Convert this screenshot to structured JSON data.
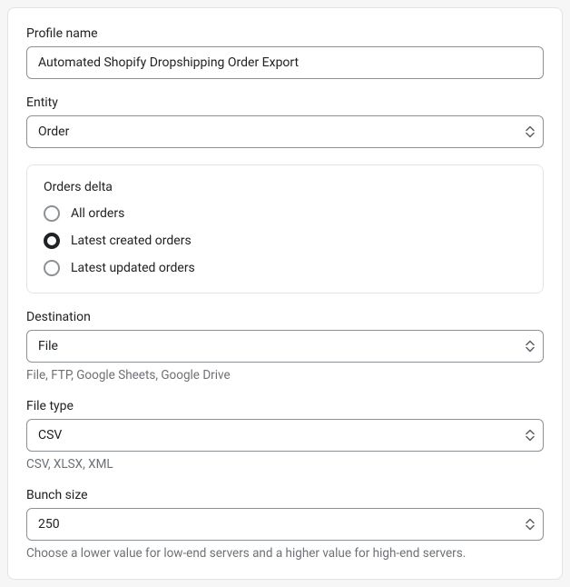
{
  "profile_name": {
    "label": "Profile name",
    "value": "Automated Shopify Dropshipping Order Export"
  },
  "entity": {
    "label": "Entity",
    "value": "Order"
  },
  "orders_delta": {
    "title": "Orders delta",
    "selected": 1,
    "options": [
      {
        "label": "All orders"
      },
      {
        "label": "Latest created orders"
      },
      {
        "label": "Latest updated orders"
      }
    ]
  },
  "destination": {
    "label": "Destination",
    "value": "File",
    "help": "File, FTP, Google Sheets, Google Drive"
  },
  "file_type": {
    "label": "File type",
    "value": "CSV",
    "help": "CSV, XLSX, XML"
  },
  "bunch_size": {
    "label": "Bunch size",
    "value": "250",
    "help": "Choose a lower value for low-end servers and a higher value for high-end servers."
  }
}
